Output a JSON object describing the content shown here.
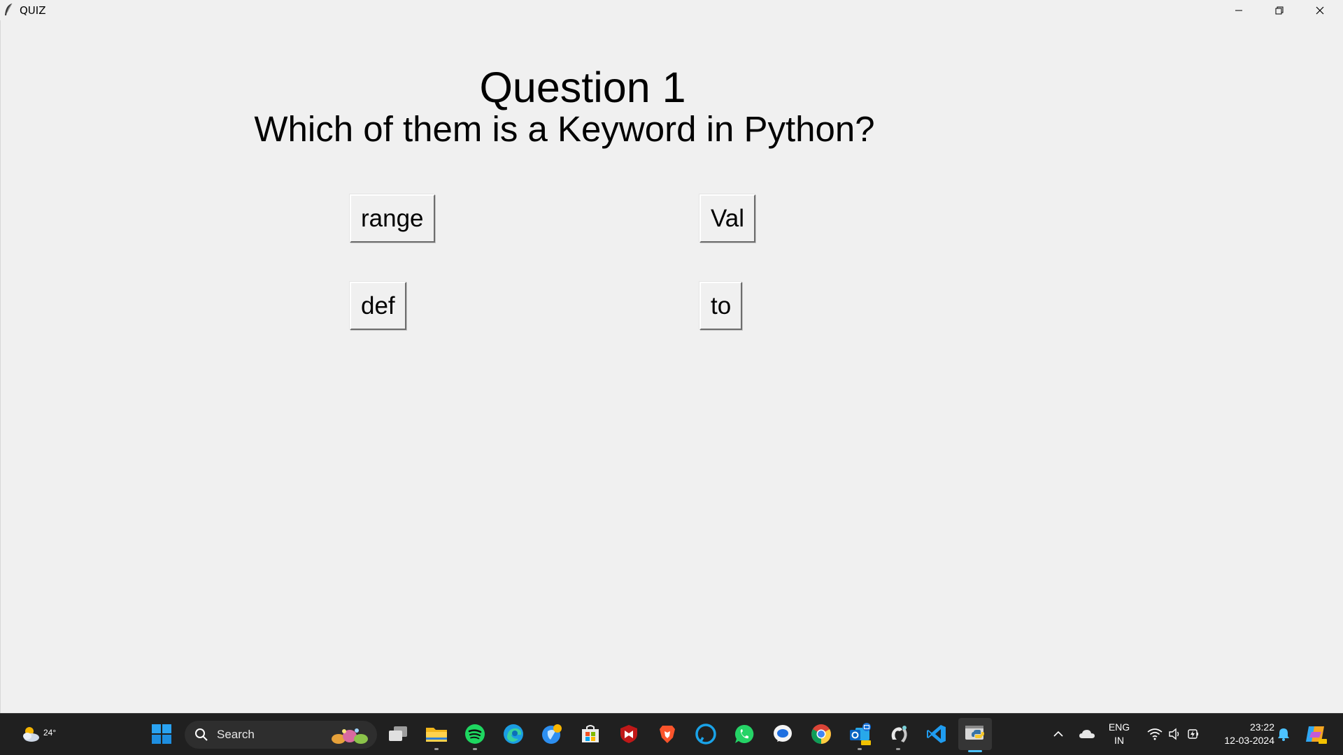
{
  "window": {
    "title": "QUIZ"
  },
  "quiz": {
    "question_title": "Question 1",
    "question_text": "Which of them is a Keyword in Python?",
    "options": [
      "range",
      "Val",
      "def",
      "to"
    ]
  },
  "taskbar": {
    "weather_temp": "24°",
    "search_placeholder": "Search",
    "pinned_icons": [
      "start-icon",
      "task-view-icon",
      "file-explorer-icon",
      "spotify-icon",
      "edge-icon",
      "browser-icon",
      "microsoft-store-icon",
      "mcafee-icon",
      "brave-icon",
      "alexa-icon",
      "whatsapp-icon",
      "messenger-icon",
      "chrome-icon",
      "outlook-icon",
      "app-icon",
      "vscode-icon",
      "python-icon"
    ],
    "language_top": "ENG",
    "language_bottom": "IN",
    "time": "23:22",
    "date": "12-03-2024"
  },
  "colors": {
    "window_bg": "#f0f0f0",
    "taskbar_bg": "#202020",
    "accent": "#4cc2ff"
  }
}
